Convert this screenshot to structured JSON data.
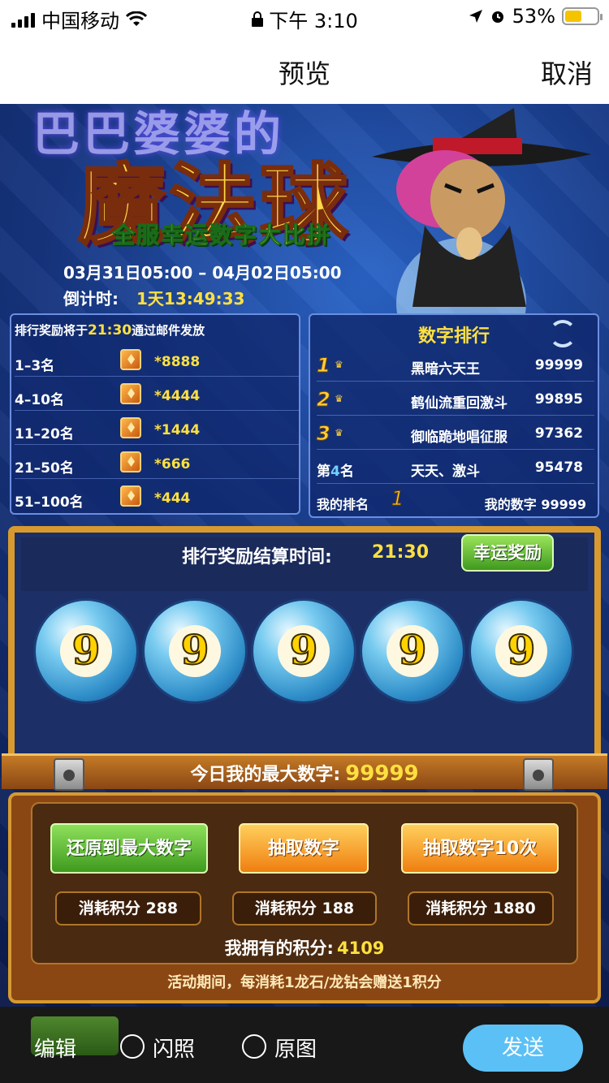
{
  "status_bar": {
    "carrier": "中国移动",
    "time": "下午 3:10",
    "battery": "53%"
  },
  "nav": {
    "title": "预览",
    "cancel": "取消"
  },
  "banner": {
    "top_text": "巴巴婆婆的",
    "title": "魔法球",
    "subtitle": "全服幸运数字大比拼",
    "dates": "03月31日05:00 – 04月02日05:00",
    "countdown_label": "倒计时:",
    "countdown_value": "1天13:49:33"
  },
  "rewards": {
    "note_prefix": "排行奖励将于",
    "note_time": "21:30",
    "note_suffix": "通过邮件发放",
    "rows": [
      {
        "rank": "1–3名",
        "amount": "*8888"
      },
      {
        "rank": "4–10名",
        "amount": "*4444"
      },
      {
        "rank": "11–20名",
        "amount": "*1444"
      },
      {
        "rank": "21–50名",
        "amount": "*666"
      },
      {
        "rank": "51–100名",
        "amount": "*444"
      }
    ]
  },
  "ranking": {
    "title": "数字排行",
    "rows": [
      {
        "medal": "1",
        "name": "黑暗六天王",
        "score": "99999"
      },
      {
        "medal": "2",
        "name": "鹤仙流重回激斗",
        "score": "99895"
      },
      {
        "medal": "3",
        "name": "御临跪地唱征服",
        "score": "97362"
      }
    ],
    "fourth": {
      "prefix": "第",
      "num": "4",
      "suffix": "名",
      "name": "天天、激斗",
      "score": "95478"
    },
    "my_rank_label": "我的排名",
    "my_rank_medal": "1",
    "my_number_label": "我的数字",
    "my_number": "99999"
  },
  "chest": {
    "settle_label": "排行奖励结算时间:",
    "settle_time": "21:30",
    "lucky_button": "幸运奖励",
    "balls": [
      "9",
      "9",
      "9",
      "9",
      "9"
    ],
    "max_today_label": "今日我的最大数字:",
    "max_today_value": "99999",
    "buttons": {
      "restore": "还原到最大数字",
      "draw": "抽取数字",
      "draw10": "抽取数字10次"
    },
    "costs": {
      "restore": "消耗积分 288",
      "draw": "消耗积分 188",
      "draw10": "消耗积分 1880"
    },
    "points_label": "我拥有的积分:",
    "points_value": "4109",
    "activity_note": "活动期间，每消耗1龙石/龙钻会赠送1积分"
  },
  "bottom": {
    "edit": "编辑",
    "flash": "闪照",
    "original": "原图",
    "send": "发送"
  },
  "colors": {
    "accent_yellow": "#ffe040",
    "send_blue": "#5bc0f5",
    "chest_gold": "#d89a2f"
  }
}
